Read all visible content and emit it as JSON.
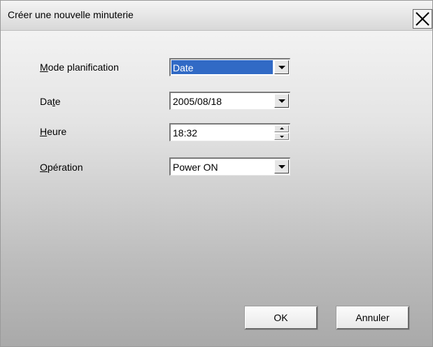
{
  "window": {
    "title": "Créer une nouvelle minuterie"
  },
  "form": {
    "mode": {
      "label_accel": "M",
      "label_rest": "ode planification",
      "value": "Date"
    },
    "date": {
      "label_before": "Da",
      "label_accel": "t",
      "label_after": "e",
      "value": "2005/08/18"
    },
    "heure": {
      "label_accel": "H",
      "label_rest": "eure",
      "value": "18:32"
    },
    "operation": {
      "label_accel": "O",
      "label_rest": "pération",
      "value": "Power ON"
    }
  },
  "buttons": {
    "ok": "OK",
    "cancel": "Annuler"
  },
  "icons": {
    "close": "close-icon",
    "dropdown": "chevron-down-icon",
    "spin_up": "spin-up-icon",
    "spin_down": "spin-down-icon"
  }
}
